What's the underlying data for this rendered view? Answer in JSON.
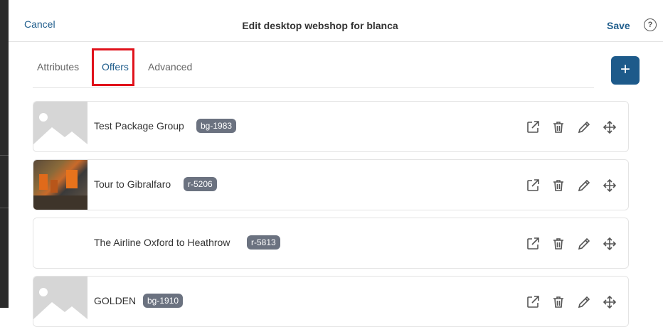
{
  "header": {
    "cancel_label": "Cancel",
    "title": "Edit desktop webshop for blanca",
    "save_label": "Save",
    "help_label": "?"
  },
  "tabs": [
    {
      "label": "Attributes",
      "active": false
    },
    {
      "label": "Offers",
      "active": true
    },
    {
      "label": "Advanced",
      "active": false
    }
  ],
  "add_button_label": "+",
  "offers": [
    {
      "name": "Test Package Group",
      "code": "bg-1983",
      "thumbnail": "placeholder-image"
    },
    {
      "name": "Tour to Gibralfaro",
      "code": "r-5206",
      "thumbnail": "photo"
    },
    {
      "name": "The Airline Oxford to Heathrow",
      "code": "r-5813",
      "thumbnail": "none"
    },
    {
      "name": "GOLDEN",
      "code": "bg-1910",
      "thumbnail": "placeholder-image"
    }
  ],
  "action_icons": [
    "external-link-icon",
    "trash-icon",
    "edit-pencil-icon",
    "move-icon"
  ],
  "colors": {
    "accent": "#1d5a8a",
    "highlight": "#e0121b",
    "badge": "#6b7280"
  }
}
